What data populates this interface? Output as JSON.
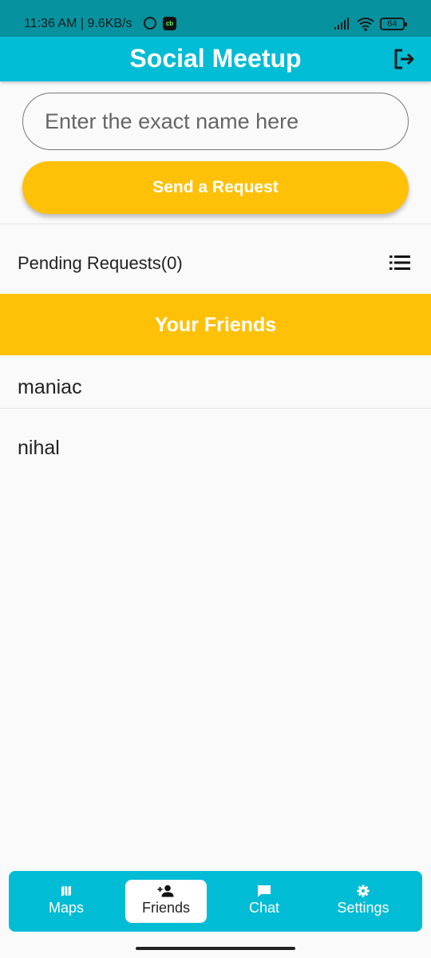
{
  "status_bar": {
    "time_speed": "11:36 AM | 9.6KB/s",
    "app_badge": "cb",
    "battery": "64"
  },
  "app_bar": {
    "title": "Social Meetup"
  },
  "search": {
    "placeholder": "Enter the exact name here",
    "value": ""
  },
  "send_button": {
    "label": "Send a Request"
  },
  "pending": {
    "label": "Pending Requests(0)"
  },
  "friends_section": {
    "header": "Your Friends",
    "items": [
      {
        "name": "maniac"
      },
      {
        "name": "nihal"
      }
    ]
  },
  "bottom_nav": {
    "items": [
      {
        "label": "Maps",
        "icon": "map-icon",
        "active": false
      },
      {
        "label": "Friends",
        "icon": "person-add-icon",
        "active": true
      },
      {
        "label": "Chat",
        "icon": "chat-bubble-icon",
        "active": false
      },
      {
        "label": "Settings",
        "icon": "gear-icon",
        "active": false
      }
    ]
  },
  "colors": {
    "primary": "#00bcd4",
    "accent": "#ffc107",
    "status_bar": "#06929f"
  }
}
